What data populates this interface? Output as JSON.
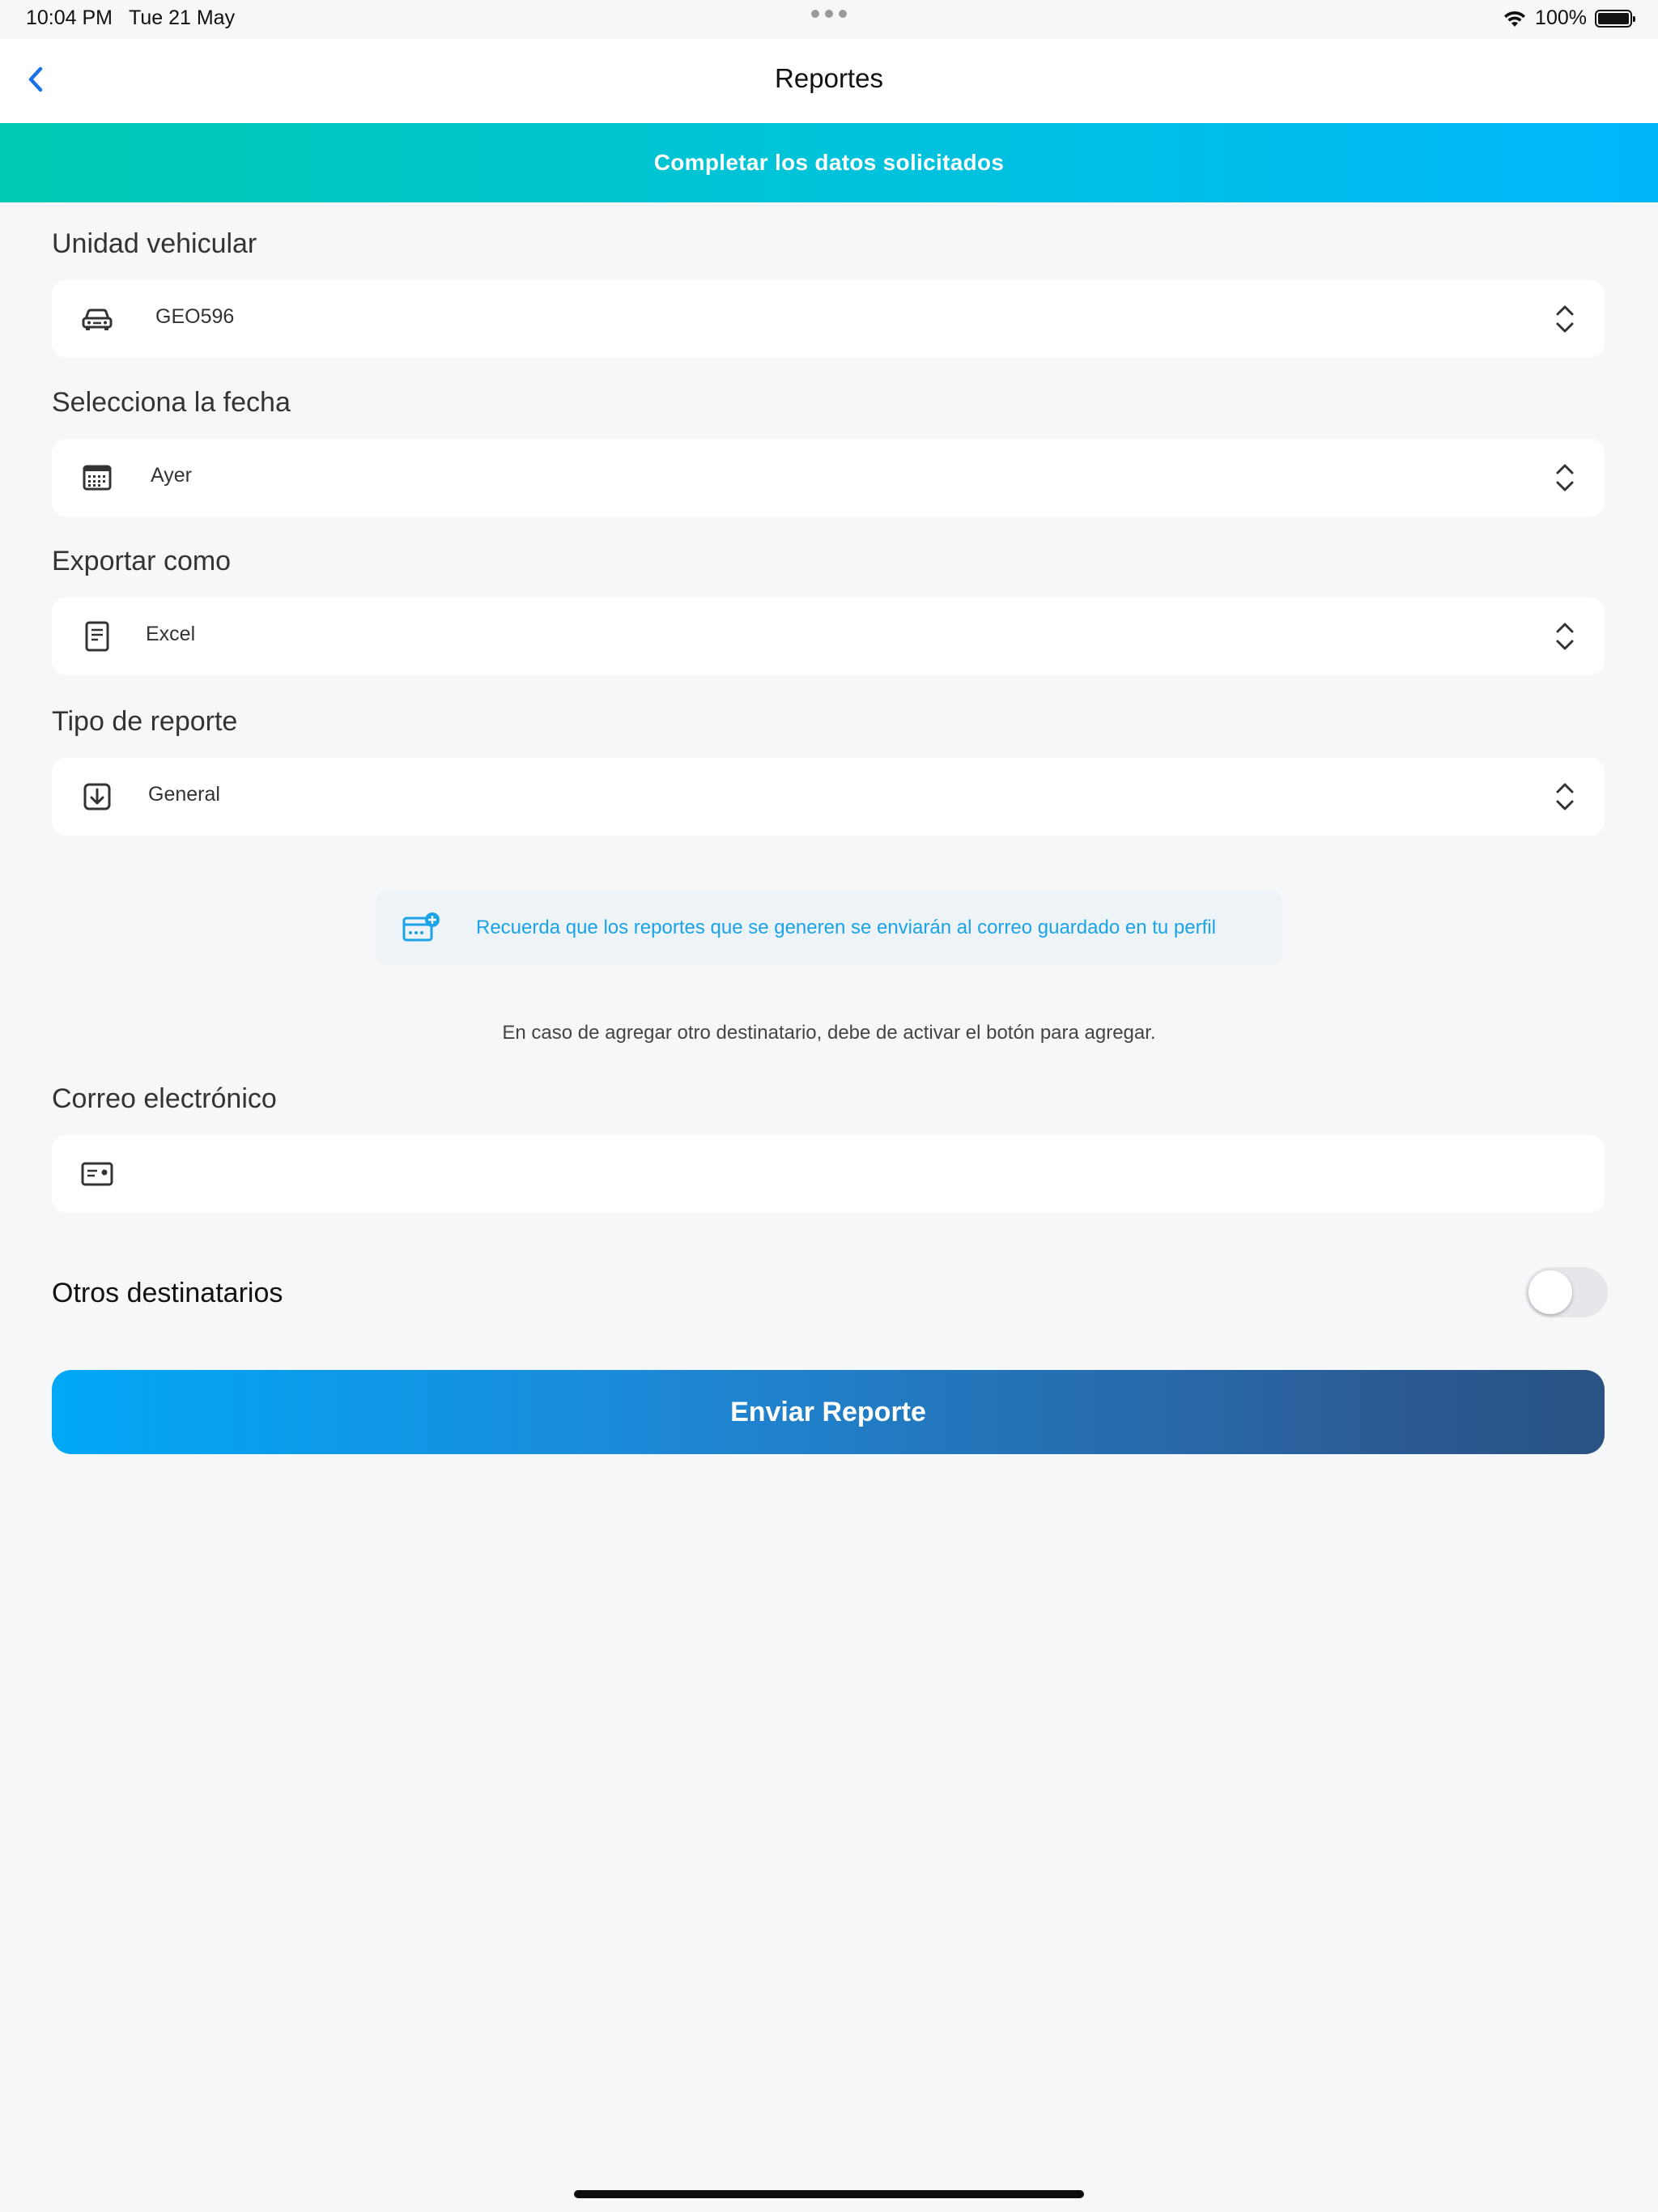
{
  "status_bar": {
    "time": "10:04 PM",
    "date": "Tue 21 May",
    "battery": "100%",
    "icons": [
      "wifi-icon",
      "battery-icon"
    ]
  },
  "nav": {
    "title": "Reportes",
    "back_icon": "chevron-left-icon"
  },
  "banner": {
    "text": "Completar los datos solicitados"
  },
  "form": {
    "vehicle": {
      "label": "Unidad vehicular",
      "value": "GEO596",
      "icon": "car-icon"
    },
    "date": {
      "label": "Selecciona la fecha",
      "value": "Ayer",
      "icon": "calendar-icon"
    },
    "export": {
      "label": "Exportar como",
      "value": "Excel",
      "icon": "document-icon"
    },
    "report_type": {
      "label": "Tipo de reporte",
      "value": "General",
      "icon": "download-icon"
    }
  },
  "notice": {
    "text": "Recuerda que los reportes que se generen se enviarán al correo guardado en tu perfil",
    "icon": "email-add-icon"
  },
  "hint": "En caso de agregar otro destinatario, debe de activar el botón para agregar.",
  "email": {
    "label": "Correo electrónico",
    "value": "",
    "icon": "id-card-icon"
  },
  "other_recipients": {
    "label": "Otros destinatarios",
    "enabled": false
  },
  "send_button": {
    "label": "Enviar Reporte"
  },
  "colors": {
    "accent": "#1aa3e8",
    "banner_start": "#00c9b1",
    "banner_end": "#00b6fb",
    "button_start": "#00a8f7",
    "button_end": "#2a5282",
    "background": "#f6f7f9"
  }
}
